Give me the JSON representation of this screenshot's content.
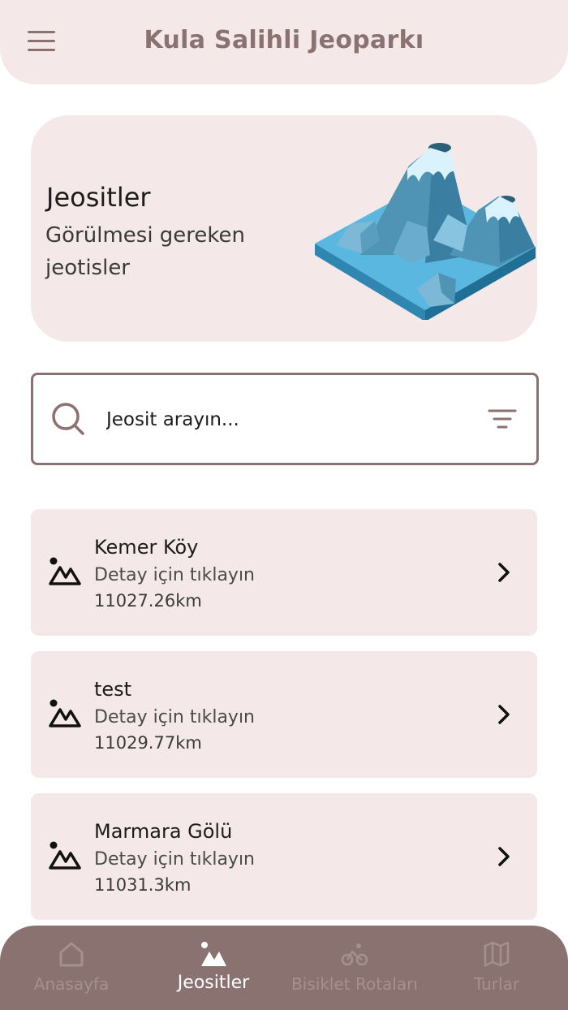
{
  "header": {
    "title": "Kula Salihli Jeoparkı",
    "menu_icon": "menu-icon"
  },
  "hero": {
    "title": "Jeositler",
    "subtitle": "Görülmesi gereken jeotisler",
    "illustration": "volcano-illustration"
  },
  "search": {
    "placeholder": "Jeosit arayın...",
    "value": "",
    "search_icon": "search-icon",
    "filter_icon": "filter-icon"
  },
  "items": [
    {
      "name": "Kemer Köy",
      "detail": "Detay için tıklayın",
      "distance": "11027.26km",
      "icon": "geosite-icon"
    },
    {
      "name": "test",
      "detail": "Detay için tıklayın",
      "distance": "11029.77km",
      "icon": "geosite-icon"
    },
    {
      "name": "Marmara Gölü",
      "detail": "Detay için tıklayın",
      "distance": "11031.3km",
      "icon": "geosite-icon"
    }
  ],
  "nav": {
    "active": "Jeositler",
    "items": [
      {
        "label": "Anasayfa",
        "icon": "home-icon"
      },
      {
        "label": "Jeositler",
        "icon": "geosite-icon"
      },
      {
        "label": "Bisiklet Rotaları",
        "icon": "bicycle-icon"
      },
      {
        "label": "Turlar",
        "icon": "map-icon"
      }
    ]
  },
  "colors": {
    "header_bg": "#f4e9e8",
    "accent": "#8a7270",
    "card_bg": "#f4e9e8",
    "nav_bg": "#8a7270",
    "nav_inactive": "#a6908e",
    "nav_active": "#ffffff"
  }
}
